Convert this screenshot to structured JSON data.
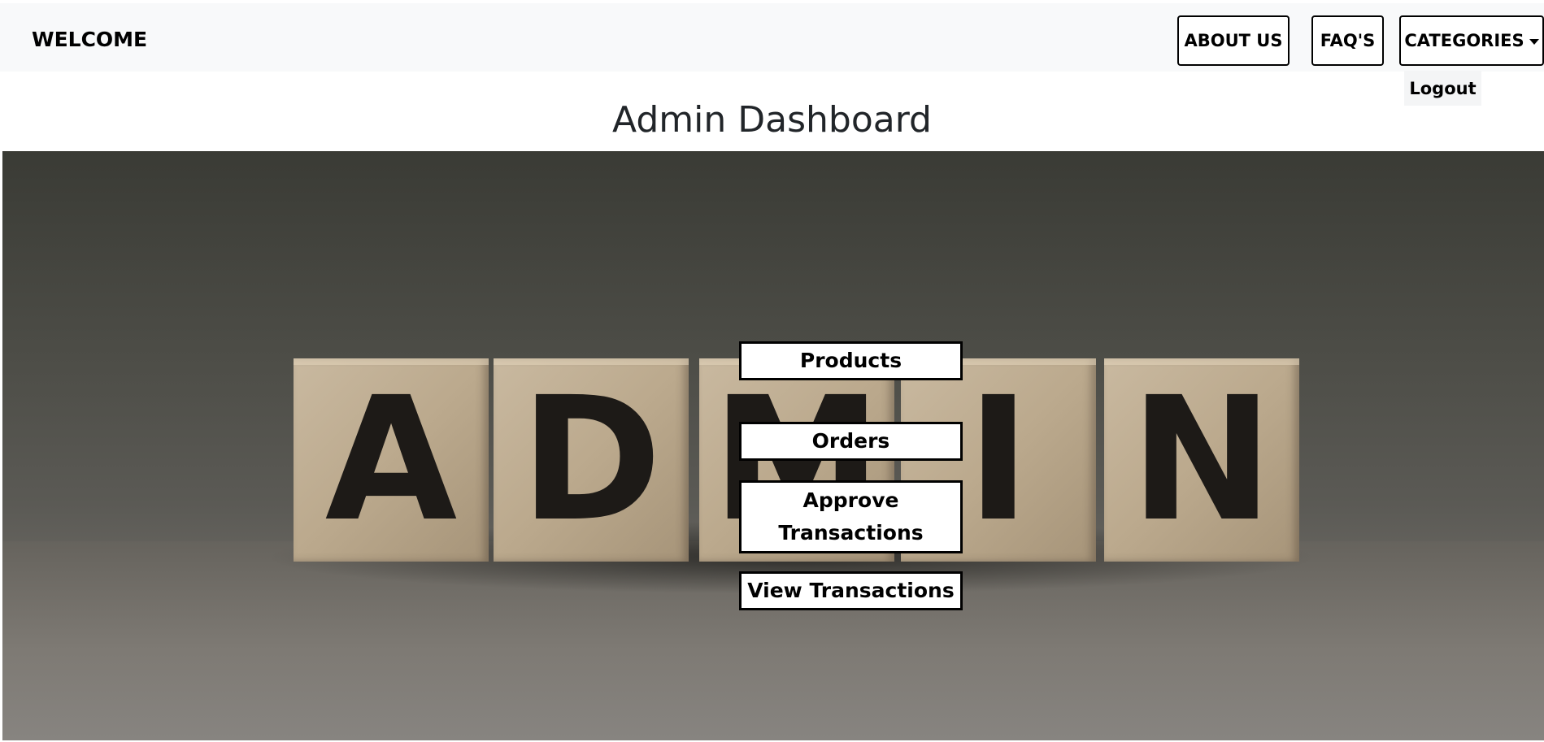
{
  "navbar": {
    "brand": "WELCOME",
    "about_label": "ABOUT US",
    "faq_label": "FAQ'S",
    "categories_label": "CATEGORIES",
    "dropdown_items": [
      "Logout"
    ]
  },
  "page": {
    "title": "Admin Dashboard"
  },
  "hero": {
    "letters": [
      "A",
      "D",
      "M",
      "I",
      "N"
    ]
  },
  "menu": {
    "products": "Products",
    "orders": "Orders",
    "approve_transactions": "Approve Transactions",
    "view_transactions": "View Transactions"
  },
  "colors": {
    "navbar_bg": "#f8f9fa",
    "button_border": "#000000",
    "title_color": "#212529"
  }
}
